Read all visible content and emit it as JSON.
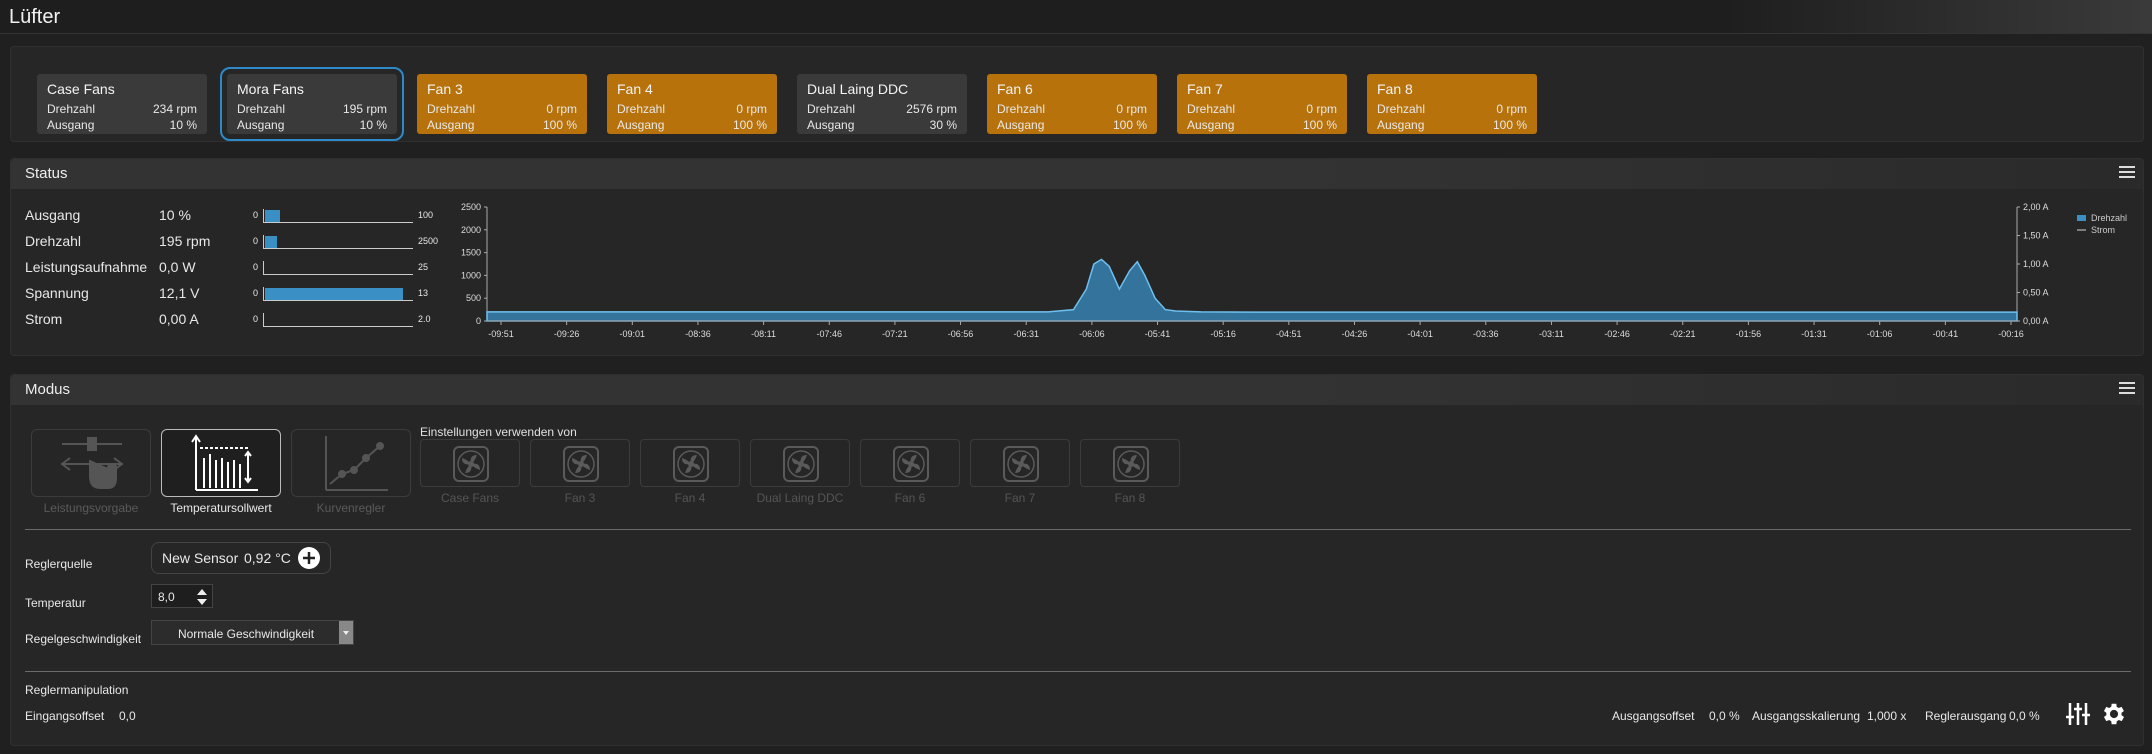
{
  "app_title": "Lüfter",
  "fan_cards": [
    {
      "name": "Case Fans",
      "speed_label": "Drehzahl",
      "speed": "234 rpm",
      "output_label": "Ausgang",
      "output": "10 %",
      "style": "gray",
      "selected": false
    },
    {
      "name": "Mora Fans",
      "speed_label": "Drehzahl",
      "speed": "195 rpm",
      "output_label": "Ausgang",
      "output": "10 %",
      "style": "gray",
      "selected": true
    },
    {
      "name": "Fan 3",
      "speed_label": "Drehzahl",
      "speed": "0 rpm",
      "output_label": "Ausgang",
      "output": "100 %",
      "style": "orange",
      "selected": false
    },
    {
      "name": "Fan 4",
      "speed_label": "Drehzahl",
      "speed": "0 rpm",
      "output_label": "Ausgang",
      "output": "100 %",
      "style": "orange",
      "selected": false
    },
    {
      "name": "Dual Laing DDC",
      "speed_label": "Drehzahl",
      "speed": "2576 rpm",
      "output_label": "Ausgang",
      "output": "30 %",
      "style": "gray",
      "selected": false
    },
    {
      "name": "Fan 6",
      "speed_label": "Drehzahl",
      "speed": "0 rpm",
      "output_label": "Ausgang",
      "output": "100 %",
      "style": "orange",
      "selected": false
    },
    {
      "name": "Fan 7",
      "speed_label": "Drehzahl",
      "speed": "0 rpm",
      "output_label": "Ausgang",
      "output": "100 %",
      "style": "orange",
      "selected": false
    },
    {
      "name": "Fan 8",
      "speed_label": "Drehzahl",
      "speed": "0 rpm",
      "output_label": "Ausgang",
      "output": "100 %",
      "style": "orange",
      "selected": false
    }
  ],
  "status": {
    "title": "Status",
    "rows": [
      {
        "label": "Ausgang",
        "value": "10 %",
        "min": "0",
        "max": "100",
        "fill": 0.1
      },
      {
        "label": "Drehzahl",
        "value": "195 rpm",
        "min": "0",
        "max": "2500",
        "fill": 0.078
      },
      {
        "label": "Leistungsaufnahme",
        "value": "0,0 W",
        "min": "0",
        "max": "25",
        "fill": 0
      },
      {
        "label": "Spannung",
        "value": "12,1 V",
        "min": "0",
        "max": "13",
        "fill": 0.93
      },
      {
        "label": "Strom",
        "value": "0,00 A",
        "min": "0",
        "max": "2.0",
        "fill": 0
      }
    ]
  },
  "chart_data": {
    "type": "area",
    "y_left_ticks": [
      "2500",
      "2000",
      "1500",
      "1000",
      "500",
      "0"
    ],
    "y_right_ticks": [
      "2,00 A",
      "1,50 A",
      "1,00 A",
      "0,50 A",
      "0,00 A"
    ],
    "x_ticks": [
      "-09:51",
      "-09:26",
      "-09:01",
      "-08:36",
      "-08:11",
      "-07:46",
      "-07:21",
      "-06:56",
      "-06:31",
      "-06:06",
      "-05:41",
      "-05:16",
      "-04:51",
      "-04:26",
      "-04:01",
      "-03:36",
      "-03:11",
      "-02:46",
      "-02:21",
      "-01:56",
      "-01:31",
      "-01:06",
      "-00:41",
      "-00:16"
    ],
    "ylim_left": [
      0,
      2500
    ],
    "ylim_right": [
      0,
      2
    ],
    "series": [
      {
        "name": "Drehzahl",
        "color": "#3a8fc4",
        "x": [
          -600,
          -380,
          -370,
          -365,
          -362,
          -359,
          -356,
          -352,
          -348,
          -345,
          -342,
          -338,
          -334,
          -330,
          -320,
          -300,
          -200,
          0
        ],
        "values": [
          200,
          200,
          250,
          700,
          1250,
          1350,
          1200,
          700,
          1100,
          1300,
          1000,
          500,
          250,
          220,
          200,
          195,
          195,
          195
        ]
      },
      {
        "name": "Strom",
        "color": "#999999",
        "x": [
          -600,
          0
        ],
        "values": [
          0,
          0
        ]
      }
    ],
    "xlim": [
      -600,
      0
    ],
    "legend_position": "top-right"
  },
  "modus": {
    "title": "Modus",
    "modes": [
      {
        "label": "Leistungsvorgabe",
        "active": false
      },
      {
        "label": "Temperatursollwert",
        "active": true
      },
      {
        "label": "Kurvenregler",
        "active": false
      }
    ],
    "settings_from_label": "Einstellungen verwenden von",
    "fans": [
      "Case Fans",
      "Fan 3",
      "Fan 4",
      "Dual Laing DDC",
      "Fan 6",
      "Fan 7",
      "Fan 8"
    ],
    "reglerquelle_label": "Reglerquelle",
    "sensor_name": "New Sensor",
    "sensor_value": "0,92 °C",
    "temperatur_label": "Temperatur",
    "temperatur_value": "8,0",
    "regelgeschwindigkeit_label": "Regelgeschwindigkeit",
    "regelgeschwindigkeit_value": "Normale Geschwindigkeit",
    "reglermanipulation_label": "Reglermanipulation",
    "eingangsoffset_label": "Eingangsoffset",
    "eingangsoffset_value": "0,0",
    "ausgangsoffset_label": "Ausgangsoffset",
    "ausgangsoffset_value": "0,0 %",
    "ausgangsskalierung_label": "Ausgangsskalierung",
    "ausgangsskalierung_value": "1,000 x",
    "reglerausgang_label": "Reglerausgang",
    "reglerausgang_value": "0,0 %"
  }
}
